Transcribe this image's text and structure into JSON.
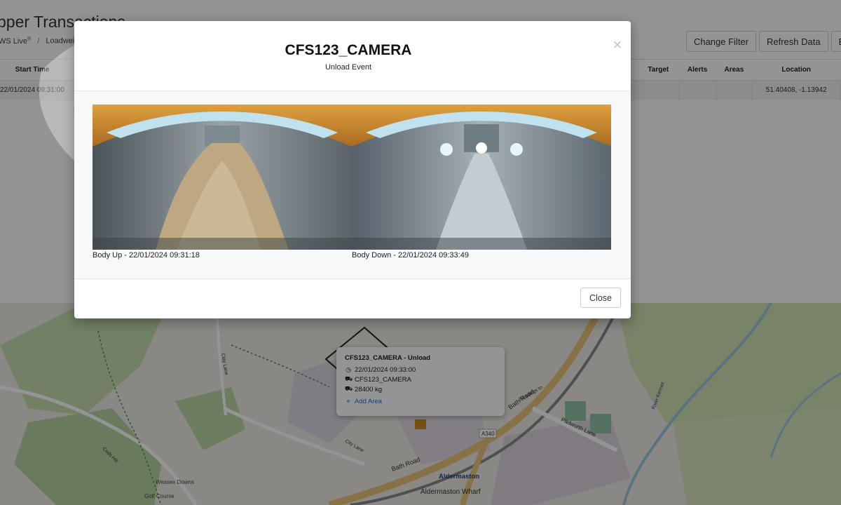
{
  "page": {
    "title": "pper Transactions",
    "breadcrumb": [
      {
        "label": "WS Live",
        "sup": "®"
      },
      {
        "label": "Loadweig"
      }
    ]
  },
  "toolbar": {
    "change_filter": "Change Filter",
    "refresh_data": "Refresh Data",
    "export": "Exp"
  },
  "table": {
    "columns": [
      "Start Time",
      "Target",
      "Alerts",
      "Areas",
      "Location"
    ],
    "row": {
      "start_time": "22/01/2024 09:31:00",
      "target": "",
      "alerts": "",
      "areas": "",
      "location": "51.40408, -1.13942"
    }
  },
  "modal": {
    "title": "CFS123_CAMERA",
    "subtitle": "Unload Event",
    "close_x": "×",
    "images": [
      {
        "caption": "Body Up - 22/01/2024 09:31:18"
      },
      {
        "caption": "Body Down - 22/01/2024 09:33:49"
      }
    ],
    "close_button": "Close"
  },
  "popup": {
    "title": "CFS123_CAMERA - Unload",
    "time": "22/01/2024 09:33:00",
    "vehicle": "CFS123_CAMERA",
    "weight": "28400 kg",
    "add_area": "Add Area"
  },
  "map": {
    "labels": {
      "bath_road": "Bath Road",
      "padworth_lane": "Padworth Lane",
      "a340": "A340",
      "aldermaston": "Aldermaston",
      "aldermaston_wharf": "Aldermaston Wharf",
      "wessex_downs": "Wessex Downs",
      "golf_course": "Golf Course",
      "clay_lane": "Clay Lane",
      "cods_hill": "Cods Hill",
      "city_lane": "City Lane",
      "readings_to": "Readings to",
      "river_kennet": "River Kennet"
    }
  },
  "icons": {
    "clock": "clock-icon",
    "truck": "truck-icon",
    "dump": "dump-truck-icon",
    "map_marker": "map-area-icon"
  }
}
